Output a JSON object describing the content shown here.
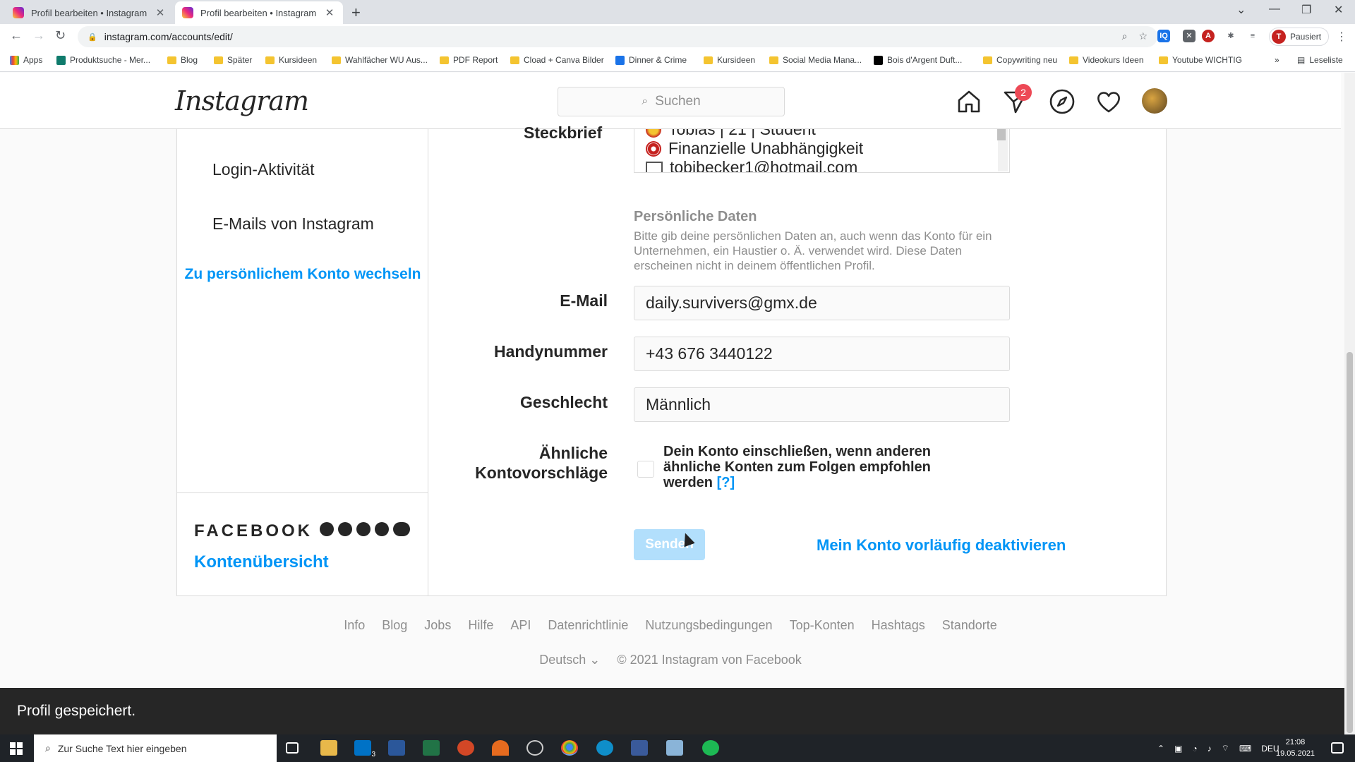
{
  "browser": {
    "tabs": [
      {
        "title": "Profil bearbeiten • Instagram",
        "active": false
      },
      {
        "title": "Profil bearbeiten • Instagram",
        "active": true
      }
    ],
    "url": "instagram.com/accounts/edit/",
    "profile_label": "Pausiert",
    "profile_initial": "T",
    "bookmarks": [
      "Apps",
      "Produktsuche - Mer...",
      "Blog",
      "Später",
      "Kursideen",
      "Wahlfächer WU Aus...",
      "PDF Report",
      "Cload + Canva Bilder",
      "Dinner & Crime",
      "Kursideen",
      "Social Media Mana...",
      "Bois d'Argent Duft...",
      "Copywriting neu",
      "Videokurs Ideen",
      "Youtube WICHTIG"
    ],
    "bookmarks_overflow": "»",
    "reading_list": "Leseliste"
  },
  "instagram": {
    "logo": "Instagram",
    "search_placeholder": "Suchen",
    "direct_badge": "2",
    "sidebar": {
      "items": [
        "Login-Aktivität",
        "E-Mails von Instagram"
      ],
      "switch_link": "Zu persönlichem Konto wechseln",
      "facebook_wordmark": "FACEBOOK",
      "accounts_center": "Kontenübersicht"
    },
    "form": {
      "bio_label": "Steckbrief",
      "bio_lines": [
        "Tobias | 21 | Student",
        "Finanzielle Unabhängigkeit",
        "tobibecker1@hotmail.com"
      ],
      "personal_title": "Persönliche Daten",
      "personal_desc": "Bitte gib deine persönlichen Daten an, auch wenn das Konto für ein Unternehmen, ein Haustier o. Ä. verwendet wird. Diese Daten erscheinen nicht in deinem öffentlichen Profil.",
      "email_label": "E-Mail",
      "email_value": "daily.survivers@gmx.de",
      "phone_label": "Handynummer",
      "phone_value": "+43 676 3440122",
      "gender_label": "Geschlecht",
      "gender_value": "Männlich",
      "similar_label_1": "Ähnliche",
      "similar_label_2": "Kontovorschläge",
      "similar_text": "Dein Konto einschließen, wenn anderen ähnliche Konten zum Folgen empfohlen werden",
      "similar_help": "[?]",
      "submit": "Senden",
      "deactivate": "Mein Konto vorläufig deaktivieren"
    },
    "footer": {
      "links": [
        "Info",
        "Blog",
        "Jobs",
        "Hilfe",
        "API",
        "Datenrichtlinie",
        "Nutzungsbedingungen",
        "Top-Konten",
        "Hashtags",
        "Standorte"
      ],
      "language": "Deutsch",
      "copyright": "© 2021 Instagram von Facebook"
    },
    "toast": "Profil gespeichert."
  },
  "taskbar": {
    "search_placeholder": "Zur Suche Text hier eingeben",
    "mail_badge": "3",
    "language": "DEU",
    "time": "21:08",
    "date": "19.05.2021"
  },
  "colors": {
    "accent": "#0095f6",
    "badge": "#ed4956",
    "toast_bg": "#262626"
  }
}
